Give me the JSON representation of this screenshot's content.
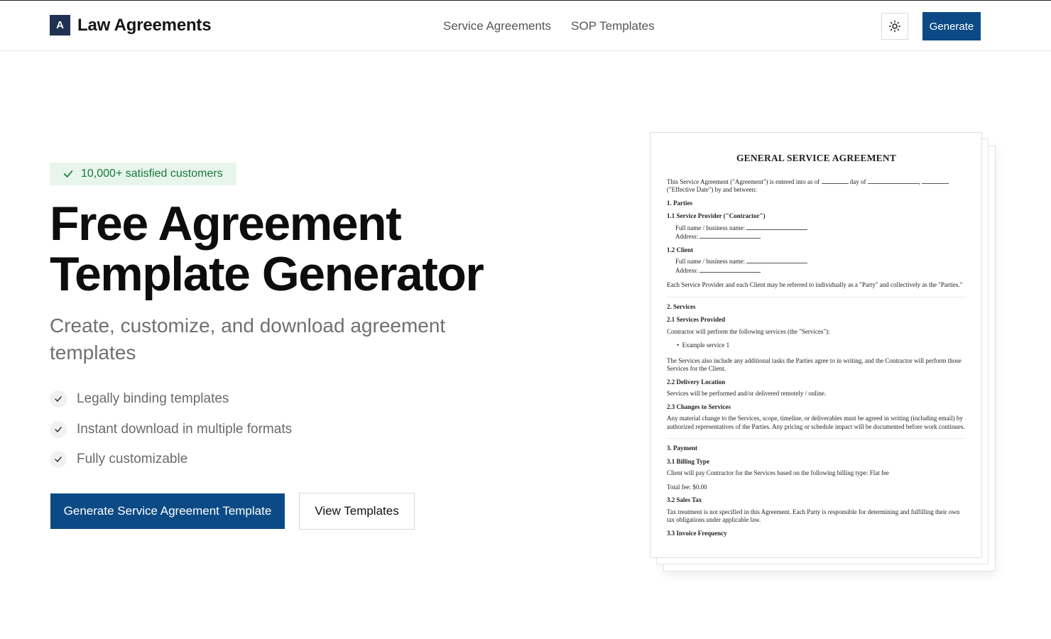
{
  "header": {
    "logo_letter": "A",
    "brand_name": "Law Agreements",
    "nav": [
      {
        "label": "Service Agreements"
      },
      {
        "label": "SOP Templates"
      }
    ],
    "theme_icon": "sun-icon",
    "generate_label": "Generate"
  },
  "hero": {
    "badge_text": "10,000+ satisfied customers",
    "title_line1": "Free Agreement",
    "title_line2": "Template Generator",
    "subtitle": "Create, customize, and download agreement templates",
    "features": [
      {
        "text": "Legally binding templates"
      },
      {
        "text": "Instant download in multiple formats"
      },
      {
        "text": "Fully customizable"
      }
    ],
    "primary_button": "Generate Service Agreement Template",
    "secondary_button": "View Templates"
  },
  "colors": {
    "primary": "#0c4a85",
    "logo_bg": "#203252",
    "badge_bg": "#e8f5ec",
    "badge_text": "#167a3a"
  },
  "document": {
    "title": "GENERAL SERVICE AGREEMENT",
    "intro_a": "This Service Agreement (\"Agreement\") is entered into as of",
    "intro_b": "day of",
    "intro_c": "(\"Effective Date\") by and between:",
    "s1_heading": "1. Parties",
    "s1_1_heading": "1.1 Service Provider (\"Contractor\")",
    "s1_1_name": "Full name / business name:",
    "s1_1_address": "Address:",
    "s1_2_heading": "1.2 Client",
    "s1_2_name": "Full name / business name:",
    "s1_2_address": "Address:",
    "s1_text": "Each Service Provider and each Client may be referred to individually as a \"Party\" and collectively as the \"Parties.\"",
    "s2_heading": "2. Services",
    "s2_1_heading": "2.1 Services Provided",
    "s2_1_text": "Contractor will perform the following services (the \"Services\"):",
    "s2_1_bullet": "Example service 1",
    "s2_1_text2": "The Services also include any additional tasks the Parties agree to in writing, and the Contractor will perform those Services for the Client.",
    "s2_2_heading": "2.2 Delivery Location",
    "s2_2_text": "Services will be performed and/or delivered remotely / online.",
    "s2_3_heading": "2.3 Changes to Services",
    "s2_3_text": "Any material change to the Services, scope, timeline, or deliverables must be agreed in writing (including email) by authorized representatives of the Parties. Any pricing or schedule impact will be documented before work continues.",
    "s3_heading": "3. Payment",
    "s3_1_heading": "3.1 Billing Type",
    "s3_1_text": "Client will pay Contractor for the Services based on the following billing type: Flat fee",
    "s3_1_total": "Total fee: $0.00",
    "s3_2_heading": "3.2 Sales Tax",
    "s3_2_text": "Tax treatment is not specified in this Agreement. Each Party is responsible for determining and fulfilling their own tax obligations under applicable law.",
    "s3_3_heading": "3.3 Invoice Frequency"
  }
}
